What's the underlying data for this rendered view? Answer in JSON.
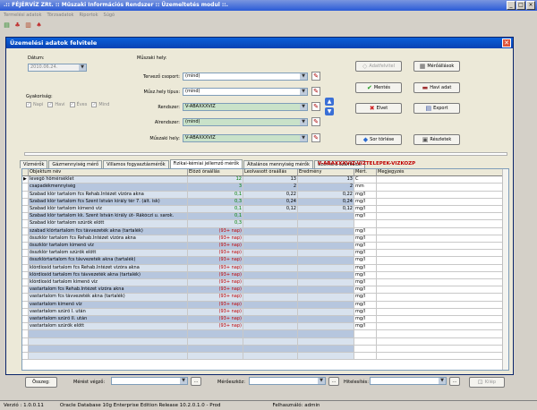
{
  "app": {
    "title": ".:: FÉJÉRVÍZ ZRt. :: Műszaki Információs Rendszer :: Üzemeltetés modul ::.",
    "menu": [
      "Termelési adatok",
      "Törzsadatok",
      "Riportok",
      "Súgó"
    ]
  },
  "dialog": {
    "title": "Üzemelési adatok felvitele",
    "close": "✕",
    "datum_label": "Dátum:",
    "datum_value": "2010.06.24.",
    "gyakorisag_label": "Gyakoriság:",
    "gyakorisag": [
      "Napi",
      "Havi",
      "Éves",
      "Mind"
    ],
    "muszaki_hely_label": "Műszaki hely:",
    "fields": [
      {
        "label": "Tervező csoport:",
        "value": "(mind)"
      },
      {
        "label": "Műsz.hely típus:",
        "value": "(mind)"
      },
      {
        "label": "Rendszer:",
        "value": "V-ABAXXXVIZ"
      },
      {
        "label": "Alrendszer:",
        "value": "(mind)"
      },
      {
        "label": "Műszaki hely:",
        "value": "V-ABAXXXVIZ"
      }
    ],
    "buttons": {
      "adatfelvitel": "Adatfelvitel",
      "mentes": "Mentés",
      "elvet": "Elvet",
      "sor_torlese": "Sor törlése",
      "meroallasok": "Mérőállások",
      "havi_adat": "Havi adat",
      "export": "Export",
      "reszletek": "Részletek"
    },
    "tabs": [
      "Vízmérők",
      "Gázmennyiség mérő",
      "Villamos fogyasztásmérők",
      "Fizikai-kémiai jellemző mérők",
      "Általános mennyiség mérők",
      "Üzemóra számlálók"
    ],
    "active_tab": 3,
    "tab_extra": "V-ABAXXXVIZ-VIZTELEPEK-VIZKOZP",
    "columns": [
      "Objektum név",
      "Előző óraállás",
      "Leolvasott óraállás",
      "Eredmény",
      "Mért.",
      "Megjegyzés"
    ],
    "rows": [
      {
        "name": "levegő hőmérséklet",
        "prev": "12",
        "read": "13",
        "res": "13",
        "unit": "C",
        "style": "lblue",
        "marker": "▶"
      },
      {
        "name": "csapadékmennyiség",
        "prev": "3",
        "read": "2",
        "res": "2",
        "unit": "mm",
        "style": "blue"
      },
      {
        "name": "Szabad klór tartalom fcs Rehab.Intézet vízóra akna",
        "prev": "0,1",
        "read": "0,22",
        "res": "0,22",
        "unit": "mg/l",
        "style": "lblue"
      },
      {
        "name": "Szabad klór tartalom fcs Szent István király tér 7. (ált. isk)",
        "prev": "0,3",
        "read": "0,24",
        "res": "0,24",
        "unit": "mg/l",
        "style": "blue"
      },
      {
        "name": "Szabad klór tartalom kimenő víz",
        "prev": "0,1",
        "read": "0,12",
        "res": "0,12",
        "unit": "mg/l",
        "style": "lblue"
      },
      {
        "name": "Szabad klór tartalom kk. Szent István király út- Rákóczi u. sarok.",
        "prev": "0,1",
        "read": "",
        "res": "",
        "unit": "mg/l",
        "style": "blue"
      },
      {
        "name": "Szabad klór tartalom szűrők előtt",
        "prev": "0,3",
        "read": "",
        "res": "",
        "unit": "",
        "style": "lblue"
      },
      {
        "name": "szabad klórtartalom fcs távvezeték akna (tartalék)",
        "prev": "(93+ nap)",
        "read": "",
        "res": "",
        "unit": "mg/l",
        "style": "blue",
        "red": true
      },
      {
        "name": "összklór tartalom fcs Rehab.Intézet vízóra akna",
        "prev": "(93+ nap)",
        "read": "",
        "res": "",
        "unit": "mg/l",
        "style": "lblue",
        "red": true
      },
      {
        "name": "összklór tartalom kimenő víz",
        "prev": "(93+ nap)",
        "read": "",
        "res": "",
        "unit": "mg/l",
        "style": "blue",
        "red": true
      },
      {
        "name": "összklór tartalom szűrők előtt",
        "prev": "(93+ nap)",
        "read": "",
        "res": "",
        "unit": "mg/l",
        "style": "lblue",
        "red": true
      },
      {
        "name": "összklórtartalom fcs távvezeték akna (tartalék)",
        "prev": "(93+ nap)",
        "read": "",
        "res": "",
        "unit": "mg/l",
        "style": "blue",
        "red": true
      },
      {
        "name": "klórdioxid tartalom fcs Rehab.Intézet vízóra akna",
        "prev": "(93+ nap)",
        "read": "",
        "res": "",
        "unit": "mg/l",
        "style": "lblue",
        "red": true
      },
      {
        "name": "klórdioxid tartalom fcs távvezeték akna (tartalék)",
        "prev": "(93+ nap)",
        "read": "",
        "res": "",
        "unit": "mg/l",
        "style": "blue",
        "red": true
      },
      {
        "name": "klórdioxid tartalom kimenő víz",
        "prev": "(93+ nap)",
        "read": "",
        "res": "",
        "unit": "mg/l",
        "style": "lblue",
        "red": true
      },
      {
        "name": "vastartalom fcs Rehab.Intézet vízóra akna",
        "prev": "(93+ nap)",
        "read": "",
        "res": "",
        "unit": "mg/l",
        "style": "blue",
        "red": true
      },
      {
        "name": "vastartalom fcs távvezeték akna (tartalék)",
        "prev": "(93+ nap)",
        "read": "",
        "res": "",
        "unit": "mg/l",
        "style": "lblue",
        "red": true
      },
      {
        "name": "vastartalom kimenő víz",
        "prev": "(93+ nap)",
        "read": "",
        "res": "",
        "unit": "mg/l",
        "style": "blue",
        "red": true
      },
      {
        "name": "vastartalom szűrő I. után",
        "prev": "(93+ nap)",
        "read": "",
        "res": "",
        "unit": "mg/l",
        "style": "lblue",
        "red": true
      },
      {
        "name": "vastartalom szűrő II. után",
        "prev": "(93+ nap)",
        "read": "",
        "res": "",
        "unit": "mg/l",
        "style": "blue",
        "red": true
      },
      {
        "name": "vastartalom szűrők előtt",
        "prev": "(93+ nap)",
        "read": "",
        "res": "",
        "unit": "mg/l",
        "style": "lblue",
        "red": true
      },
      {
        "name": "",
        "prev": "",
        "read": "",
        "res": "",
        "unit": "",
        "style": "blue"
      },
      {
        "name": "",
        "prev": "",
        "read": "",
        "res": "",
        "unit": "",
        "style": "lblue"
      },
      {
        "name": "",
        "prev": "",
        "read": "",
        "res": "",
        "unit": "",
        "style": "blue"
      },
      {
        "name": "",
        "prev": "",
        "read": "",
        "res": "",
        "unit": "",
        "style": "lblue"
      }
    ],
    "bottom": {
      "osszeg": "Összeg:",
      "merest_vegzo": "Mérést végző:",
      "meroeszkoz": "Mérőeszköz:",
      "hitelesites": "Hitelesítés:",
      "kilep": "Kilép"
    }
  },
  "statusbar": {
    "version": "Verzió : 1.0.0.11",
    "db": "Oracle Database 10g Enterprise Edition Release 10.2.0.1.0 - Prod",
    "user": "Felhasználó: admin"
  },
  "colors": {
    "title_blue": "#0a5fd9",
    "row_blue": "#b6c6de",
    "overdue_red": "#c00000",
    "ok_green": "#008000"
  }
}
